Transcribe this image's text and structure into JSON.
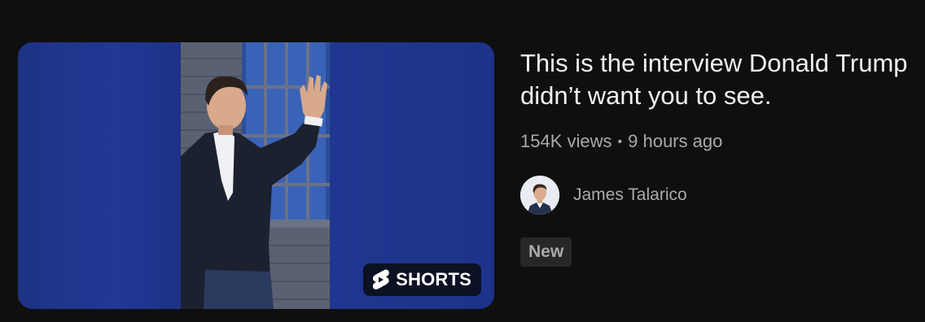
{
  "video": {
    "title": "This is the interview Donald Trump didn’t want you to see.",
    "views": "154K views",
    "separator": "•",
    "age": "9 hours ago",
    "badge": "New"
  },
  "thumbnail": {
    "overlay_label": "SHORTS",
    "overlay_icon": "youtube-shorts-icon",
    "background_color": "#1e3286"
  },
  "channel": {
    "name": "James Talarico",
    "avatar_icon": "channel-avatar"
  },
  "colors": {
    "page_background": "#0f0f0f",
    "title": "#f1f1f1",
    "secondary_text": "#aaaaaa",
    "badge_background": "#272727"
  }
}
